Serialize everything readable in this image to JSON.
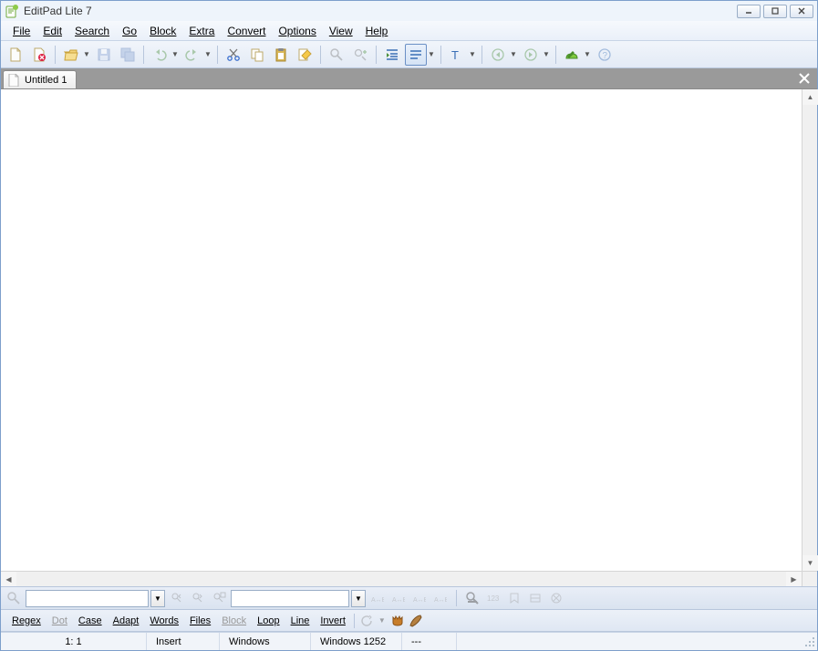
{
  "window": {
    "title": "EditPad Lite 7"
  },
  "menu": {
    "file": "File",
    "edit": "Edit",
    "search": "Search",
    "go": "Go",
    "block": "Block",
    "extra": "Extra",
    "convert": "Convert",
    "options": "Options",
    "view": "View",
    "help": "Help"
  },
  "toolbar_icons": {
    "new": "new",
    "close": "close",
    "open": "open",
    "save": "save",
    "saveall": "saveall",
    "back": "back",
    "forward": "forward",
    "cut": "cut",
    "copy": "copy",
    "paste": "paste",
    "edit": "edit",
    "zoomout": "zoomout",
    "zoomin": "zoomin",
    "indent": "indent",
    "wrap": "wrap",
    "font": "font",
    "navback": "navback",
    "navfwd": "navfwd",
    "check": "check",
    "help": "help"
  },
  "tab": {
    "label": "Untitled 1"
  },
  "options": {
    "regex": "Regex",
    "dot": "Dot",
    "case": "Case",
    "adapt": "Adapt",
    "words": "Words",
    "files": "Files",
    "block": "Block",
    "loop": "Loop",
    "line": "Line",
    "invert": "Invert"
  },
  "status": {
    "position": "1: 1",
    "mode": "Insert",
    "encoding": "Windows",
    "codepage": "Windows 1252",
    "dash": "---"
  }
}
